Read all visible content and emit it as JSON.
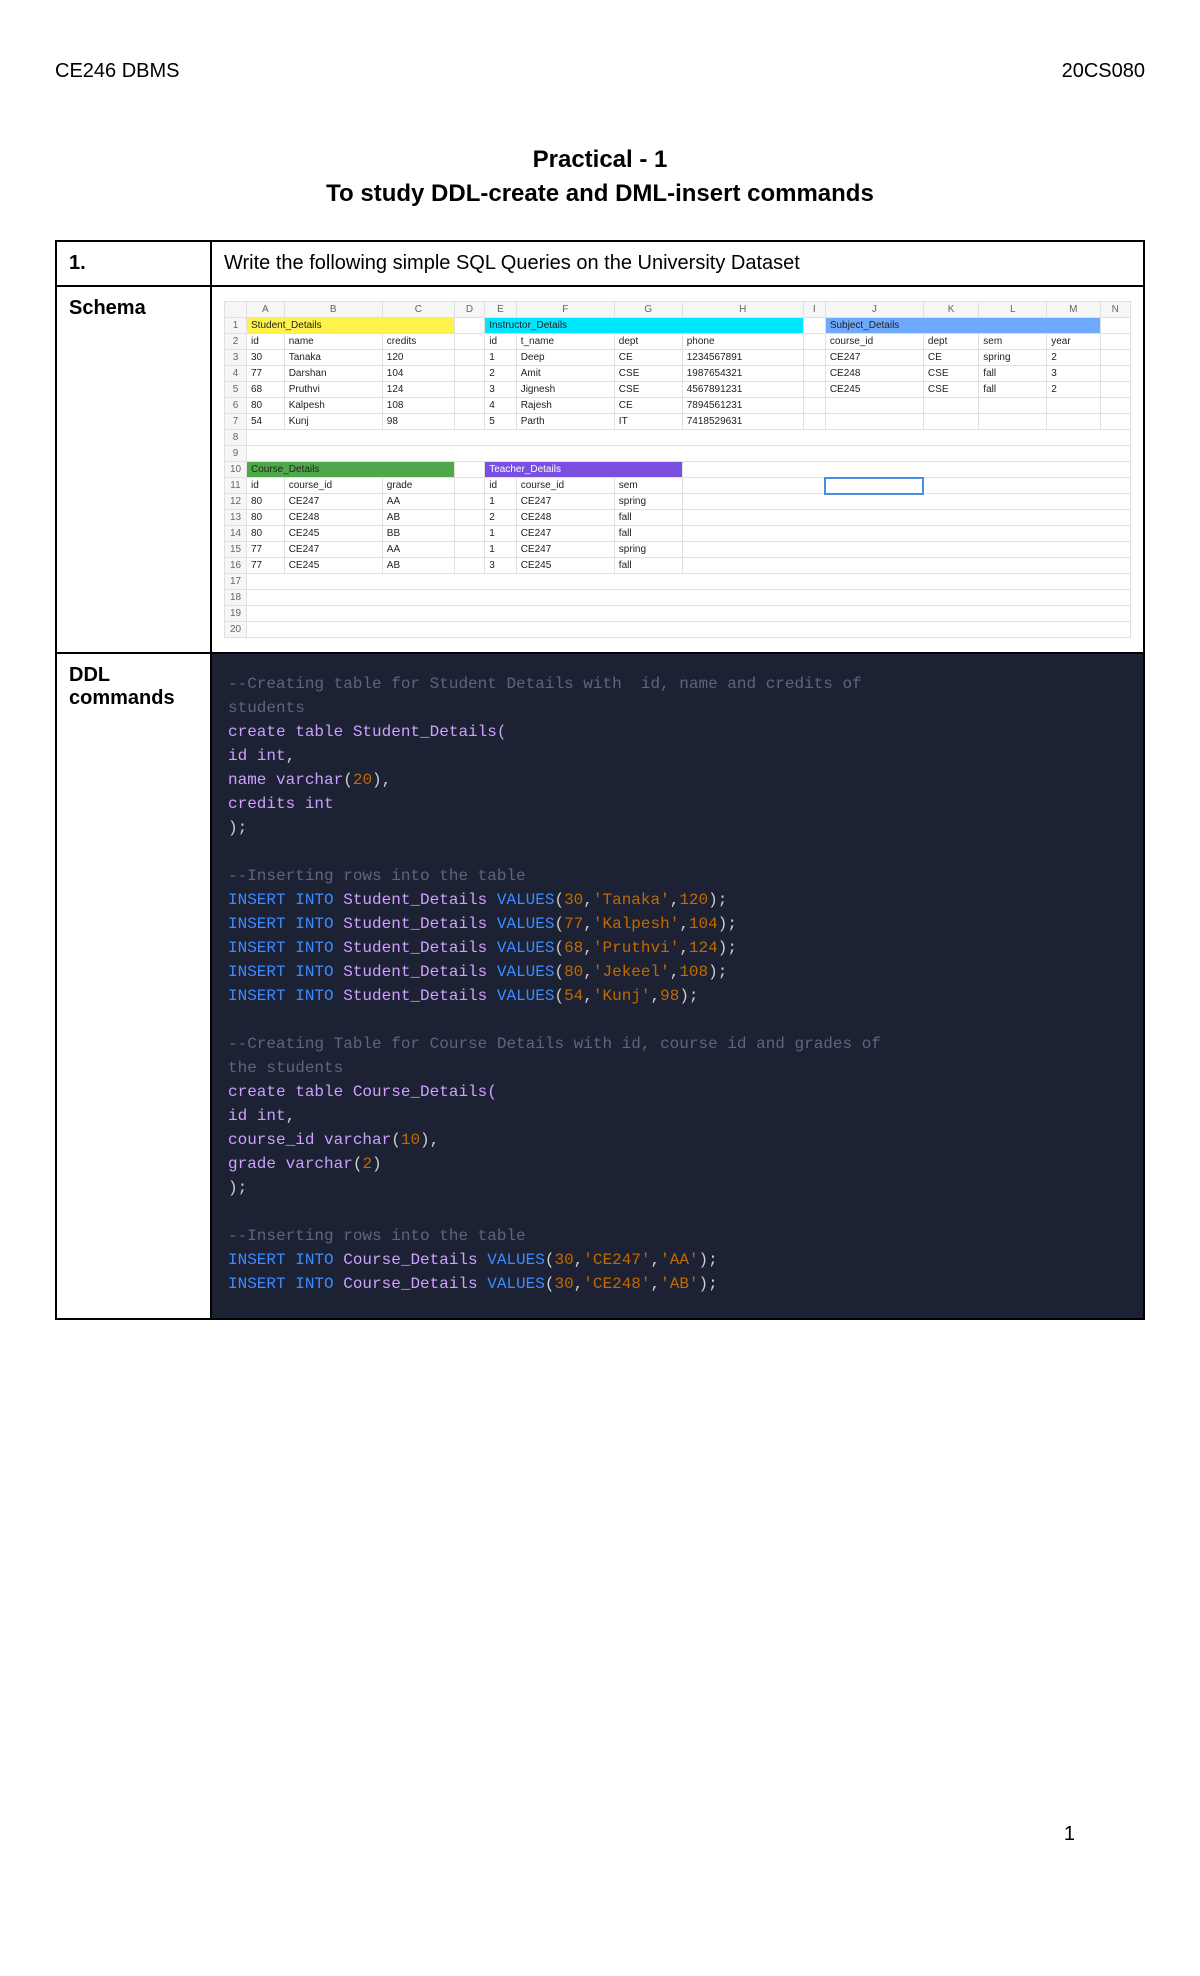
{
  "header": {
    "left": "CE246 DBMS",
    "right": "20CS080"
  },
  "title": {
    "line1": "Practical - 1",
    "line2": "To study DDL-create and DML-insert commands"
  },
  "rows": {
    "q_num": "1.",
    "q_text": "Write the following simple SQL Queries on the University Dataset",
    "schema_label": "Schema",
    "ddl_label": "DDL commands"
  },
  "sheet": {
    "cols": [
      "A",
      "B",
      "C",
      "D",
      "E",
      "F",
      "G",
      "H",
      "I",
      "J",
      "K",
      "L",
      "M",
      "N"
    ],
    "section_student": "Student_Details",
    "section_instructor": "Instructor_Details",
    "section_subject": "Subject_Details",
    "section_course": "Course_Details",
    "section_teacher": "Teacher_Details",
    "student_headers": [
      "id",
      "name",
      "credits"
    ],
    "students": [
      [
        "30",
        "Tanaka",
        "120"
      ],
      [
        "77",
        "Darshan",
        "104"
      ],
      [
        "68",
        "Pruthvi",
        "124"
      ],
      [
        "80",
        "Kalpesh",
        "108"
      ],
      [
        "54",
        "Kunj",
        "98"
      ]
    ],
    "instructor_headers": [
      "id",
      "t_name",
      "dept",
      "phone"
    ],
    "instructors": [
      [
        "1",
        "Deep",
        "CE",
        "1234567891"
      ],
      [
        "2",
        "Amit",
        "CSE",
        "1987654321"
      ],
      [
        "3",
        "Jignesh",
        "CSE",
        "4567891231"
      ],
      [
        "4",
        "Rajesh",
        "CE",
        "7894561231"
      ],
      [
        "5",
        "Parth",
        "IT",
        "7418529631"
      ]
    ],
    "subject_headers": [
      "course_id",
      "dept",
      "sem",
      "year"
    ],
    "subjects": [
      [
        "CE247",
        "CE",
        "spring",
        "2"
      ],
      [
        "CE248",
        "CSE",
        "fall",
        "3"
      ],
      [
        "CE245",
        "CSE",
        "fall",
        "2"
      ]
    ],
    "course_headers": [
      "id",
      "course_id",
      "grade"
    ],
    "courses": [
      [
        "80",
        "CE247",
        "AA"
      ],
      [
        "80",
        "CE248",
        "AB"
      ],
      [
        "80",
        "CE245",
        "BB"
      ],
      [
        "77",
        "CE247",
        "AA"
      ],
      [
        "77",
        "CE245",
        "AB"
      ]
    ],
    "teacher_headers": [
      "id",
      "course_id",
      "sem"
    ],
    "teachers": [
      [
        "1",
        "CE247",
        "spring"
      ],
      [
        "2",
        "CE248",
        "fall"
      ],
      [
        "1",
        "CE247",
        "fall"
      ],
      [
        "1",
        "CE247",
        "spring"
      ],
      [
        "3",
        "CE245",
        "fall"
      ]
    ]
  },
  "code": {
    "c1": "--Creating table for Student Details with  id, name and credits of",
    "c1b": "students",
    "l1": "create table",
    "l1b": " Student_Details(",
    "l2a": "id ",
    "l2b": "int",
    "l2c": ",",
    "l3a": "name ",
    "l3b": "varchar",
    "l3c": "(",
    "l3d": "20",
    "l3e": "),",
    "l4a": "credits ",
    "l4b": "int",
    "l5": ");",
    "c2": "--Inserting rows into the table",
    "ins": "INSERT INTO",
    "sd": " Student_Details ",
    "val": "VALUES",
    "i1a": "(",
    "i1b": "30",
    "i1c": ",",
    "i1d": "'Tanaka'",
    "i1e": ",",
    "i1f": "120",
    "i1g": ");",
    "i2b": "77",
    "i2d": "'Kalpesh'",
    "i2f": "104",
    "i3b": "68",
    "i3d": "'Pruthvi'",
    "i3f": "124",
    "i4b": "80",
    "i4d": "'Jekeel'",
    "i4f": "108",
    "i5b": "54",
    "i5d": "'Kunj'",
    "i5f": "98",
    "c3a": "--Creating Table for Course Details with id, course id and grades of",
    "c3b": "the students",
    "l6b": " Course_Details(",
    "l7a": "id ",
    "l7b": "int",
    "l7c": ",",
    "l8a": "course_id ",
    "l8b": "varchar",
    "l8c": "(",
    "l8d": "10",
    "l8e": "),",
    "l9a": "grade ",
    "l9b": "varchar",
    "l9c": "(",
    "l9d": "2",
    "l9e": ")",
    "cd": " Course_Details ",
    "j1b": "30",
    "j1d": "'CE247'",
    "j1f": "'AA'",
    "j2b": "30",
    "j2d": "'CE248'",
    "j2f": "'AB'"
  },
  "page_number": "1"
}
